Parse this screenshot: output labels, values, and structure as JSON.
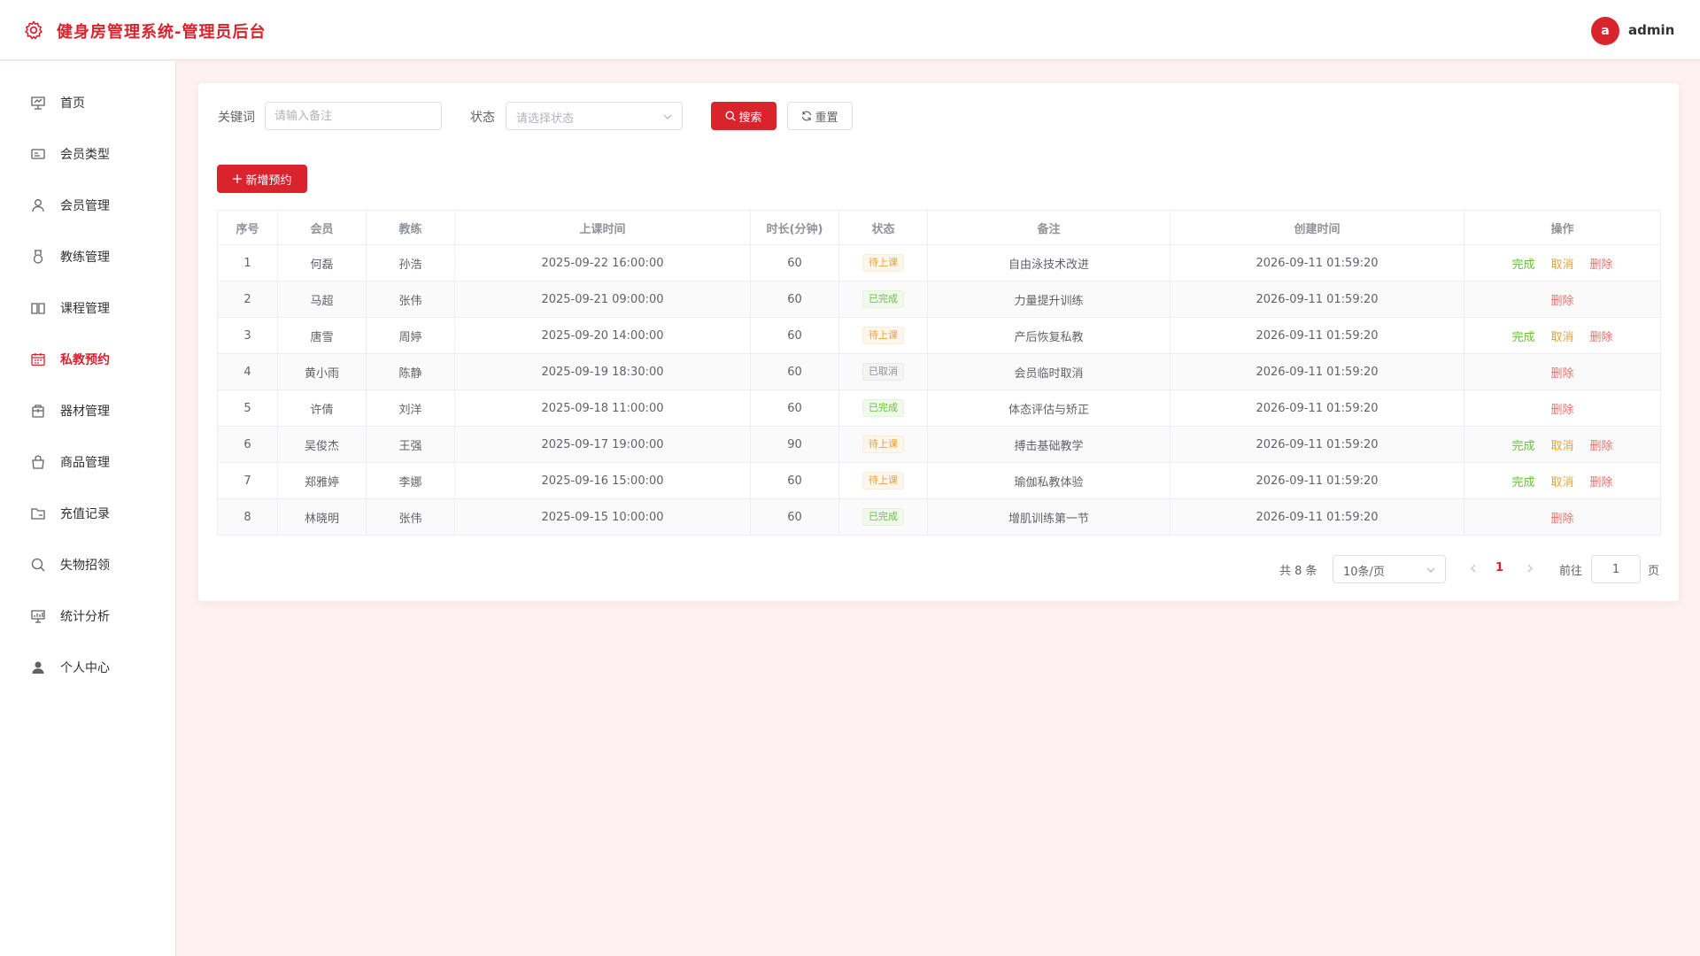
{
  "header": {
    "title": "健身房管理系统-管理员后台",
    "avatar_letter": "a",
    "username": "admin"
  },
  "sidebar": {
    "items": [
      {
        "label": "首页",
        "icon": "dashboard-icon"
      },
      {
        "label": "会员类型",
        "icon": "id-card-icon"
      },
      {
        "label": "会员管理",
        "icon": "user-icon"
      },
      {
        "label": "教练管理",
        "icon": "medal-icon"
      },
      {
        "label": "课程管理",
        "icon": "book-icon"
      },
      {
        "label": "私教预约",
        "icon": "calendar-icon",
        "active": true
      },
      {
        "label": "器材管理",
        "icon": "box-icon"
      },
      {
        "label": "商品管理",
        "icon": "shopping-bag-icon"
      },
      {
        "label": "充值记录",
        "icon": "folder-icon"
      },
      {
        "label": "失物招领",
        "icon": "search-icon"
      },
      {
        "label": "统计分析",
        "icon": "chart-icon"
      },
      {
        "label": "个人中心",
        "icon": "avatar-icon"
      }
    ]
  },
  "filters": {
    "keyword_label": "关键词",
    "keyword_placeholder": "请输入备注",
    "keyword_value": "",
    "status_label": "状态",
    "status_placeholder": "请选择状态",
    "search_label": "搜索",
    "reset_label": "重置"
  },
  "toolbar": {
    "add_label": "新增预约"
  },
  "table": {
    "columns": [
      "序号",
      "会员",
      "教练",
      "上课时间",
      "时长(分钟)",
      "状态",
      "备注",
      "创建时间",
      "操作"
    ],
    "actions": {
      "complete": "完成",
      "cancel": "取消",
      "delete": "删除"
    },
    "rows": [
      {
        "index": "1",
        "member": "何磊",
        "coach": "孙浩",
        "time": "2025-09-22 16:00:00",
        "duration": "60",
        "status": "待上课",
        "status_type": "warning",
        "note": "自由泳技术改进",
        "created": "2026-09-11 01:59:20",
        "actions": [
          "complete",
          "cancel",
          "delete"
        ]
      },
      {
        "index": "2",
        "member": "马超",
        "coach": "张伟",
        "time": "2025-09-21 09:00:00",
        "duration": "60",
        "status": "已完成",
        "status_type": "success",
        "note": "力量提升训练",
        "created": "2026-09-11 01:59:20",
        "actions": [
          "delete"
        ]
      },
      {
        "index": "3",
        "member": "唐雪",
        "coach": "周婷",
        "time": "2025-09-20 14:00:00",
        "duration": "60",
        "status": "待上课",
        "status_type": "warning",
        "note": "产后恢复私教",
        "created": "2026-09-11 01:59:20",
        "actions": [
          "complete",
          "cancel",
          "delete"
        ]
      },
      {
        "index": "4",
        "member": "黄小雨",
        "coach": "陈静",
        "time": "2025-09-19 18:30:00",
        "duration": "60",
        "status": "已取消",
        "status_type": "info",
        "note": "会员临时取消",
        "created": "2026-09-11 01:59:20",
        "actions": [
          "delete"
        ]
      },
      {
        "index": "5",
        "member": "许倩",
        "coach": "刘洋",
        "time": "2025-09-18 11:00:00",
        "duration": "60",
        "status": "已完成",
        "status_type": "success",
        "note": "体态评估与矫正",
        "created": "2026-09-11 01:59:20",
        "actions": [
          "delete"
        ]
      },
      {
        "index": "6",
        "member": "吴俊杰",
        "coach": "王强",
        "time": "2025-09-17 19:00:00",
        "duration": "90",
        "status": "待上课",
        "status_type": "warning",
        "note": "搏击基础教学",
        "created": "2026-09-11 01:59:20",
        "actions": [
          "complete",
          "cancel",
          "delete"
        ]
      },
      {
        "index": "7",
        "member": "郑雅婷",
        "coach": "李娜",
        "time": "2025-09-16 15:00:00",
        "duration": "60",
        "status": "待上课",
        "status_type": "warning",
        "note": "瑜伽私教体验",
        "created": "2026-09-11 01:59:20",
        "actions": [
          "complete",
          "cancel",
          "delete"
        ]
      },
      {
        "index": "8",
        "member": "林晓明",
        "coach": "张伟",
        "time": "2025-09-15 10:00:00",
        "duration": "60",
        "status": "已完成",
        "status_type": "success",
        "note": "增肌训练第一节",
        "created": "2026-09-11 01:59:20",
        "actions": [
          "delete"
        ]
      }
    ]
  },
  "pagination": {
    "total_text": "共 8 条",
    "page_size": "10条/页",
    "current_page": "1",
    "goto_prefix": "前往",
    "goto_value": "1",
    "goto_suffix": "页"
  },
  "colors": {
    "brand": "#d9232d",
    "success": "#67c23a",
    "warning": "#e6a23c",
    "danger": "#f56c6c",
    "background": "#fdf1f1"
  }
}
